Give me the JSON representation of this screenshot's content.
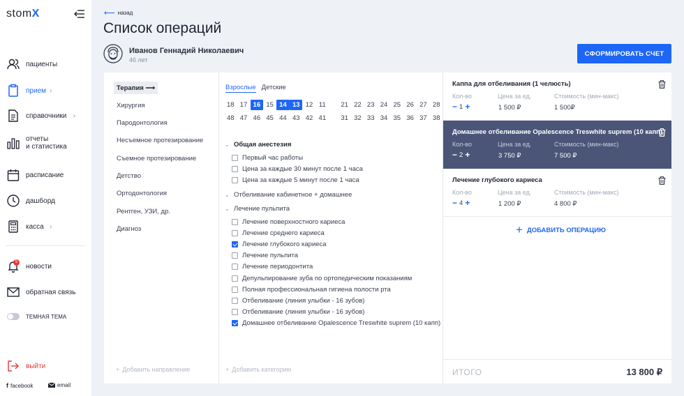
{
  "app": {
    "logo_text": "stom",
    "logo_x": "X",
    "accent": "#1e66f5",
    "highlight": "#4a5578"
  },
  "sidebar": {
    "items": [
      {
        "label": "пациенты",
        "icon": "users-icon"
      },
      {
        "label": "прием",
        "icon": "clipboard-icon",
        "active": true,
        "chevron": "›"
      },
      {
        "label": "справочники",
        "icon": "document-icon",
        "chevron": "›"
      },
      {
        "label": "отчеты\nи статистика",
        "icon": "bar-chart-icon"
      },
      {
        "label": "расписание",
        "icon": "calendar-icon"
      },
      {
        "label": "дашборд",
        "icon": "clock-icon"
      },
      {
        "label": "касса",
        "icon": "calculator-icon",
        "chevron": "›"
      }
    ],
    "news": {
      "label": "новости",
      "badge": "5"
    },
    "feedback": {
      "label": "обратная связь"
    },
    "theme": {
      "label": "ТЕМНАЯ ТЕМА"
    },
    "logout": {
      "label": "выйти"
    },
    "social": {
      "facebook": "facebook",
      "email": "email"
    }
  },
  "header": {
    "back": "назад",
    "title": "Список операций",
    "patient_name": "Иванов Геннадий Николаевич",
    "patient_age": "46 лет",
    "primary_button": "СФОРМИРОВАТЬ СЧЕТ"
  },
  "directions": {
    "items": [
      "Терапия",
      "Хирургия",
      "Пародонтология",
      "Несъемное протезирование",
      "Съемное протезирование",
      "Детство",
      "Ортодонтология",
      "Рентген, УЗИ, др.",
      "Диагноз"
    ],
    "active_index": 0,
    "active_arrow": "⟶",
    "add_label": "Добавить направление"
  },
  "teeth": {
    "tabs": [
      {
        "label": "Взрослые",
        "active": true
      },
      {
        "label": "Детские",
        "active": false
      }
    ],
    "upper_left": [
      "18",
      "17",
      "16",
      "15",
      "14",
      "13",
      "12",
      "11"
    ],
    "upper_right": [
      "21",
      "22",
      "23",
      "24",
      "25",
      "26",
      "27",
      "28"
    ],
    "lower_left": [
      "48",
      "47",
      "46",
      "45",
      "44",
      "43",
      "42",
      "41"
    ],
    "lower_right": [
      "31",
      "32",
      "33",
      "34",
      "35",
      "36",
      "37",
      "38"
    ],
    "selected": [
      "16",
      "14",
      "13"
    ]
  },
  "categories": [
    {
      "name": "Общая анестезия",
      "open": true,
      "ops": [
        {
          "label": "Первый час работы",
          "checked": false
        },
        {
          "label": "Цена за каждые 30 минут после 1 часа",
          "checked": false
        },
        {
          "label": "Цена за каждые 5 минут после 1 часа",
          "checked": false
        }
      ]
    },
    {
      "name": "Отбеливание кабинетное + домашнее",
      "open": false,
      "ops": []
    },
    {
      "name": "Лечение пульпита",
      "open": false,
      "ops": [
        {
          "label": "Лечение поверхностного кариеса",
          "checked": false
        },
        {
          "label": "Лечение среднего кариеса",
          "checked": false
        },
        {
          "label": "Лечение глубокого кариеса",
          "checked": true
        },
        {
          "label": "Лечение пульпита",
          "checked": false
        },
        {
          "label": "Лечение периодонтита",
          "checked": false
        },
        {
          "label": "Депульпирование зуба по ортопедическим показаниям",
          "checked": false
        },
        {
          "label": "Полная профессиональная гигиена полости рта",
          "checked": false
        },
        {
          "label": "Отбеливание (линия улыбки - 16 зубов)",
          "checked": false
        },
        {
          "label": "Отбеливание (линия улыбки - 16 зубов)",
          "checked": false
        },
        {
          "label": "Домашнее отбеливание Opalescence Treswhite suprem (10 капп)",
          "checked": true
        }
      ]
    }
  ],
  "add_category": "Добавить категорию",
  "selected_ops": {
    "col_qty": "Кол-во",
    "col_price": "Цена за ед.",
    "col_cost": "Стоимость (мин-макс)",
    "items": [
      {
        "name": "Каппа для отбеливания (1 челюсть)",
        "qty": "1",
        "price": "1 500 ₽",
        "cost": "1 500₽",
        "highlighted": false
      },
      {
        "name": "Домашнее отбеливание Opalescence Treswhite suprem (10 капп)",
        "qty": "2",
        "price": "3 750 ₽",
        "cost": "7 500 ₽",
        "highlighted": true
      },
      {
        "name": "Лечение глубокого кариеса",
        "qty": "4",
        "price": "1 200 ₽",
        "cost": "4 800 ₽",
        "highlighted": false
      }
    ],
    "add_label": "ДОБАВИТЬ ОПЕРАЦИЮ",
    "total_label": "ИТОГО",
    "total_value": "13 800 ₽"
  }
}
